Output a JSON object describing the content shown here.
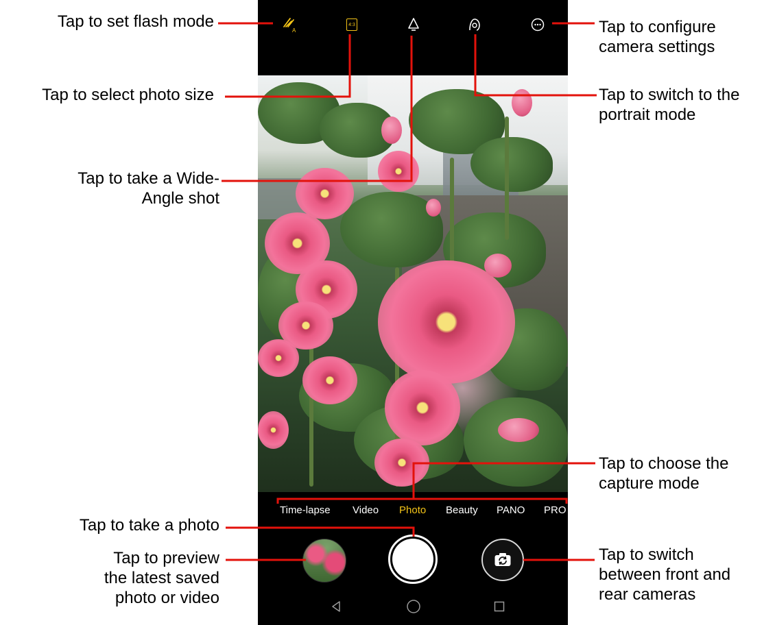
{
  "camera": {
    "top_bar": {
      "flash_icon": "flash-auto-icon",
      "photo_size_label": "4:3",
      "wide_angle_icon": "wide-angle-icon",
      "portrait_icon": "portrait-mode-icon",
      "settings_icon": "more-options-icon"
    },
    "modes": [
      "Time-lapse",
      "Video",
      "Photo",
      "Beauty",
      "PANO",
      "PRO"
    ],
    "active_mode": "Photo",
    "accent_color": "#f5c518",
    "bottom": {
      "gallery_icon": "gallery-thumbnail",
      "shutter_icon": "shutter-button",
      "switch_icon": "switch-camera-icon"
    },
    "nav": {
      "back_icon": "back-triangle-icon",
      "home_icon": "home-circle-icon",
      "recents_icon": "recents-square-icon"
    }
  },
  "callouts": {
    "flash": "Tap to set flash mode",
    "photo_size": "Tap to select photo size",
    "wide_angle": "Tap to take a Wide-\nAngle shot",
    "take_photo": "Tap to take a photo",
    "preview": "Tap to preview\nthe latest saved\nphoto or video",
    "settings": "Tap to configure\ncamera settings",
    "portrait": "Tap to switch to the\nportrait mode",
    "capture_mode": "Tap to choose the\ncapture mode",
    "switch_camera": "Tap to switch\nbetween front and\nrear cameras"
  },
  "callout_line_color": "#e3120b"
}
